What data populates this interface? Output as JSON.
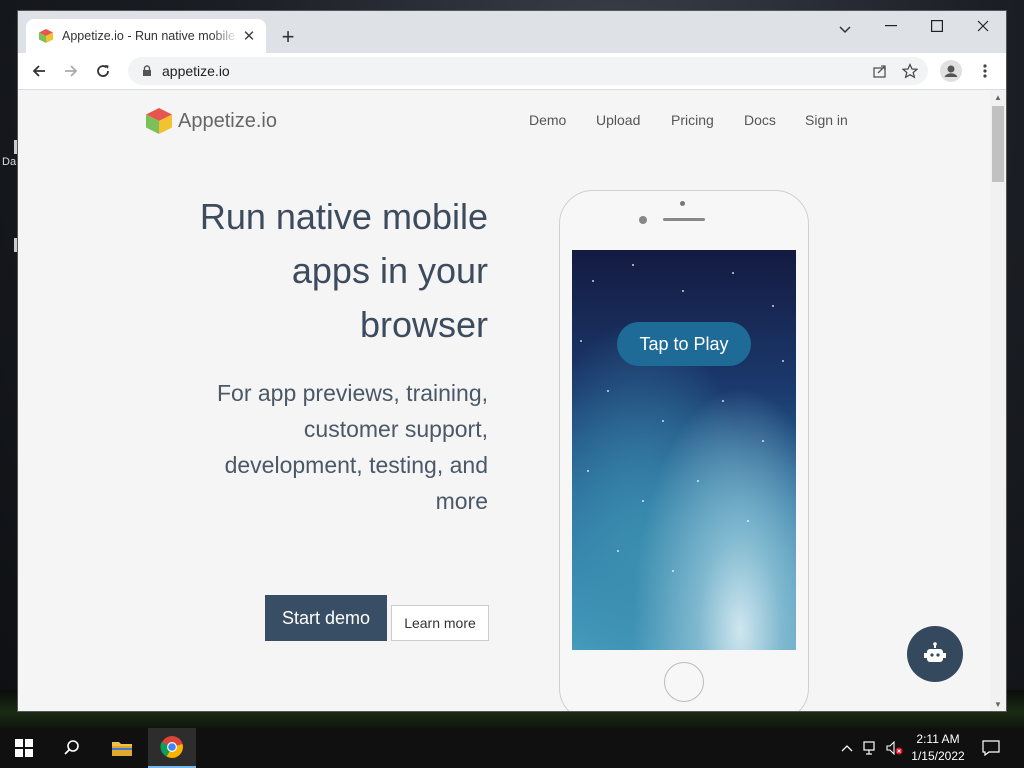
{
  "browser": {
    "tab_title": "Appetize.io - Run native mobile apps in your browser",
    "url": "appetize.io"
  },
  "page": {
    "brand_name": "Appetize.io",
    "nav": [
      {
        "label": "Demo"
      },
      {
        "label": "Upload"
      },
      {
        "label": "Pricing"
      },
      {
        "label": "Docs"
      },
      {
        "label": "Sign in"
      }
    ],
    "headline_lines": [
      "Run native mobile",
      "apps in your",
      "browser"
    ],
    "subline_lines": [
      "For app previews, training,",
      "customer support,",
      "development, testing, and",
      "more"
    ],
    "start_demo": "Start demo",
    "learn_more": "Learn more",
    "tap_to_play": "Tap to Play"
  },
  "desktop": {
    "side_text": "Da"
  },
  "taskbar": {
    "time": "2:11 AM",
    "date": "1/15/2022"
  },
  "colors": {
    "accent_dark": "#384e64",
    "tap_button": "#1f6b98",
    "heading": "#3c4b5e"
  }
}
